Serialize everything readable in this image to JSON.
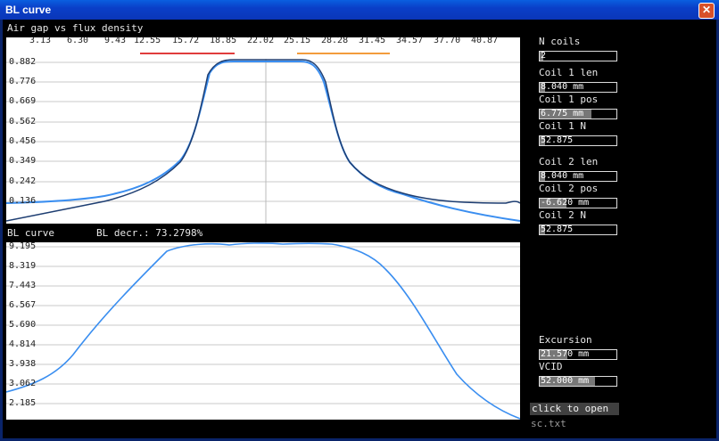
{
  "window": {
    "title": "BL curve",
    "close_glyph": "✕"
  },
  "top_plot": {
    "label": "Air gap vs flux density",
    "x_ticks": [
      "3.13",
      "6.30",
      "9.43",
      "12.55",
      "15.72",
      "18.85",
      "22.02",
      "25.15",
      "28.28",
      "31.45",
      "34.57",
      "37.70",
      "40.87"
    ],
    "y_ticks": [
      "0.882",
      "0.776",
      "0.669",
      "0.562",
      "0.456",
      "0.349",
      "0.242",
      "0.136"
    ]
  },
  "bottom_plot": {
    "label": "BL curve",
    "decrease_text": "BL decr.: 73.2798%",
    "y_ticks": [
      "9.195",
      "8.319",
      "7.443",
      "6.567",
      "5.690",
      "4.814",
      "3.938",
      "3.062",
      "2.185"
    ]
  },
  "controls": {
    "n_coils": {
      "label": "N coils",
      "value": "2",
      "fill": 0.05
    },
    "coil1_len": {
      "label": "Coil 1 len",
      "value": "8.040 mm",
      "fill": 0.07
    },
    "coil1_pos": {
      "label": "Coil 1 pos",
      "value": "6.775 mm",
      "fill": 0.68
    },
    "coil1_n": {
      "label": "Coil 1 N",
      "value": "52.875",
      "fill": 0.07
    },
    "coil2_len": {
      "label": "Coil 2 len",
      "value": "8.040 mm",
      "fill": 0.07
    },
    "coil2_pos": {
      "label": "Coil 2 pos",
      "value": "-6.620 mm",
      "fill": 0.35
    },
    "coil2_n": {
      "label": "Coil 2 N",
      "value": "52.875",
      "fill": 0.07
    },
    "excursion": {
      "label": "Excursion",
      "value": "21.570 mm",
      "fill": 0.36
    },
    "vcid": {
      "label": "VCID",
      "value": "52.000 mm",
      "fill": 0.72
    }
  },
  "open_button": "click to open",
  "file_name": "sc.txt",
  "colors": {
    "coil1_marker": "#e03c3c",
    "coil2_marker": "#f39c3c",
    "flux_curve": "#1e3e72",
    "fitted_curve": "#3a8ef0",
    "bl_curve": "#3a8ef0"
  }
}
